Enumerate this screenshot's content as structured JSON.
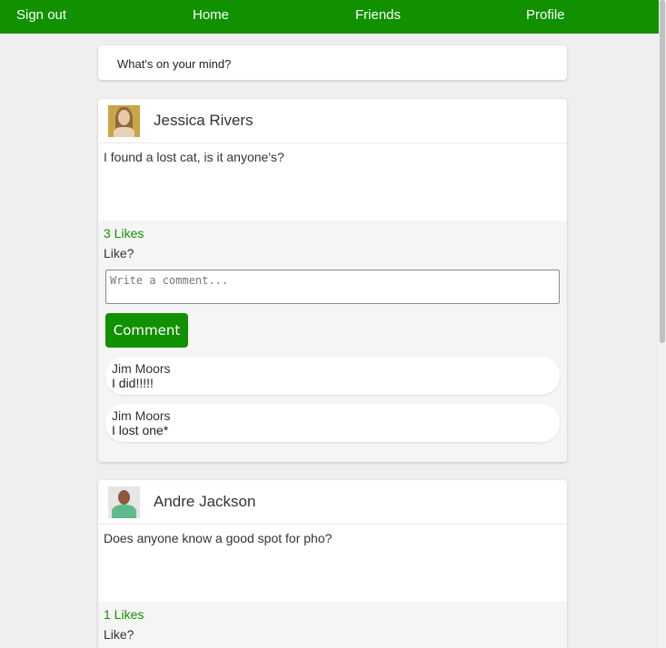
{
  "nav": {
    "sign_out": "Sign out",
    "home": "Home",
    "friends": "Friends",
    "profile": "Profile"
  },
  "status_prompt": "What's on your mind?",
  "posts": [
    {
      "author": "Jessica Rivers",
      "text": "I found a lost cat, is it anyone's?",
      "likes": "3 Likes",
      "like_label": "Like?",
      "comment_placeholder": "Write a comment...",
      "comment_button": "Comment",
      "comments": [
        {
          "author": "Jim Moors",
          "text": "I did!!!!!"
        },
        {
          "author": "Jim Moors",
          "text": "I lost one*"
        }
      ]
    },
    {
      "author": "Andre Jackson",
      "text": "Does anyone know a good spot for pho?",
      "likes": "1 Likes",
      "like_label": "Like?"
    }
  ],
  "colors": {
    "brand": "#119000",
    "background": "#efefef"
  }
}
